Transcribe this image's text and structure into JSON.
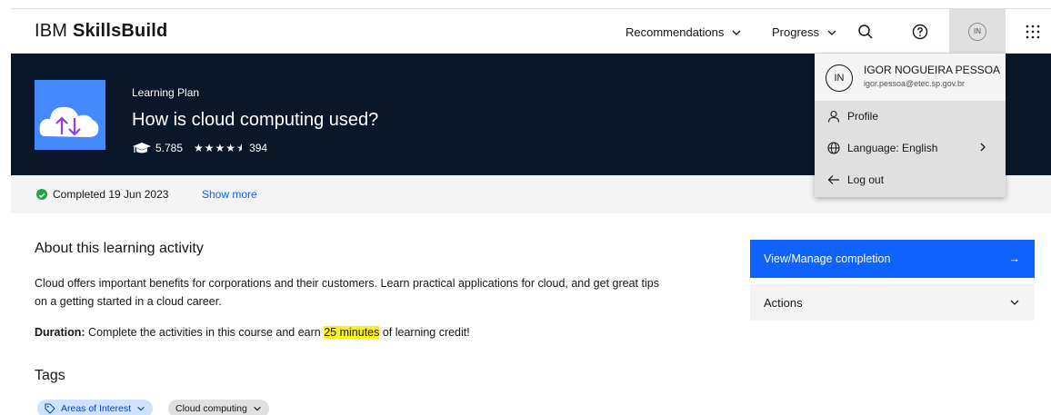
{
  "header": {
    "brand_prefix": "IBM",
    "brand_name": "SkillsBuild",
    "nav_recommendations": "Recommendations",
    "nav_progress": "Progress",
    "avatar_initials": "IN"
  },
  "hero": {
    "kicker": "Learning Plan",
    "title": "How is cloud computing used?",
    "learners": "5.785",
    "stars": "★★★★",
    "rating_count": "394"
  },
  "status": {
    "completed": "Completed 19 Jun 2023",
    "show_more": "Show more"
  },
  "about": {
    "title": "About this learning activity",
    "body": "Cloud offers important benefits for corporations and their customers. Learn practical applications for cloud, and get great tips on a getting started in a cloud career.",
    "duration_label": "Duration:",
    "duration_pre": "Complete the activities in this course and earn ",
    "duration_highlight": "25 minutes",
    "duration_post": " of learning credit!"
  },
  "tags": {
    "title": "Tags",
    "items": [
      "Areas of Interest",
      "Cloud computing"
    ]
  },
  "sidebar": {
    "cta_label": "View/Manage completion",
    "cta_arrow": "→",
    "actions_label": "Actions"
  },
  "user_menu": {
    "initials": "IN",
    "name": "IGOR NOGUEIRA PESSOA",
    "email": "igor.pessoa@etec.sp.gov.br",
    "profile": "Profile",
    "language": "Language: English",
    "logout": "Log out"
  },
  "colors": {
    "hero_bg": "#0a1729",
    "primary": "#0f62fe",
    "success": "#24a148",
    "highlight": "#fdee21"
  }
}
